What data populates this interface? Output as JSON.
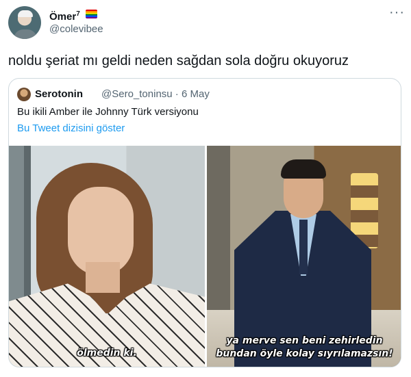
{
  "author": {
    "display_name": "Ömer",
    "display_name_sup": "7",
    "handle": "@colevibee",
    "flag_icon": "rainbow-flag-icon",
    "more_icon": "more-options-icon",
    "more_glyph": "···"
  },
  "tweet": {
    "text": "noldu şeriat mı geldi neden sağdan sola doğru okuyoruz"
  },
  "quoted_tweet": {
    "display_name": "Serotonin",
    "handle": "@Sero_toninsu",
    "separator": "·",
    "date": "6 May",
    "text": "Bu ikili Amber ile Johnny Türk versiyonu",
    "thread_link": "Bu Tweet dizisini göster",
    "media": [
      {
        "subtitle_lines": [
          "ölmedin ki."
        ]
      },
      {
        "subtitle_lines": [
          "ya merve sen beni zehirledin",
          "bundan öyle kolay sıyrılamazsın!"
        ]
      }
    ]
  },
  "colors": {
    "text_primary": "#0f1419",
    "text_secondary": "#536471",
    "link": "#1d9bf0",
    "border": "#cfd9de"
  }
}
